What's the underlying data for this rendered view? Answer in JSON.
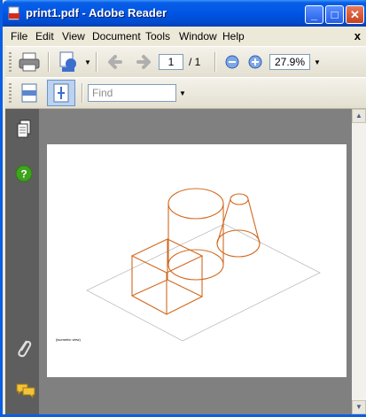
{
  "window": {
    "title": "print1.pdf - Adobe Reader",
    "caption_buttons": {
      "minimize": "_",
      "maximize": "□",
      "close": "✕"
    }
  },
  "menu": {
    "items": [
      "File",
      "Edit",
      "View",
      "Document",
      "Tools",
      "Window",
      "Help"
    ],
    "close_glyph": "x"
  },
  "toolbar": {
    "current_page": "1",
    "page_total": "/ 1",
    "zoom": "27.9%",
    "find_placeholder": "Find"
  },
  "page": {
    "caption": "(isometric view)"
  },
  "colors": {
    "drawing_stroke": "#D2691E",
    "plane_stroke": "#BDBDBD"
  }
}
